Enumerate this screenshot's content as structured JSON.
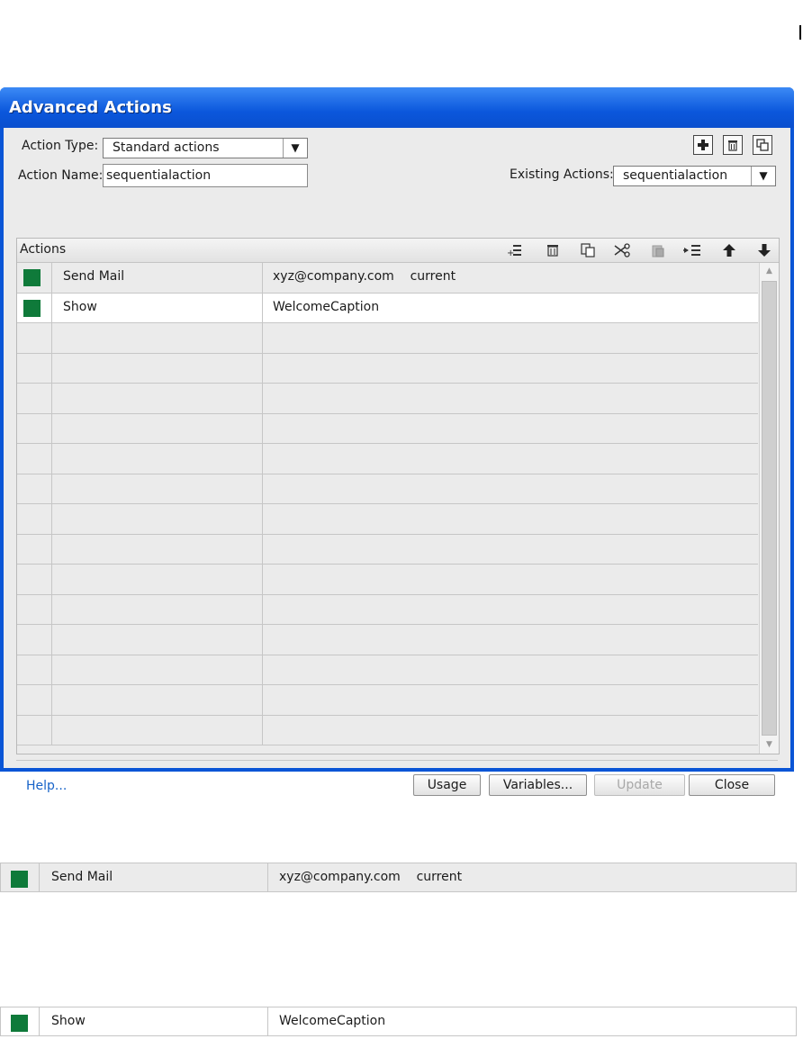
{
  "dialog": {
    "title": "Advanced Actions",
    "action_type_label": "Action Type:",
    "action_type_value": "Standard actions",
    "action_name_label": "Action Name:",
    "action_name_value": "sequentialaction",
    "existing_actions_label": "Existing Actions:",
    "existing_actions_value": "sequentialaction",
    "top_icons": [
      "add-icon",
      "trash-icon",
      "duplicate-icon"
    ],
    "grid": {
      "header_label": "Actions",
      "toolbar_icons": [
        "insert-row-icon",
        "delete-row-icon",
        "copy-icon",
        "cut-icon",
        "paste-icon",
        "indent-icon",
        "move-up-icon",
        "move-down-icon"
      ],
      "rows": [
        {
          "color": "#0f7a3a",
          "action": "Send Mail",
          "target": "xyz@company.com    current"
        },
        {
          "color": "#0f7a3a",
          "action": "Show",
          "target": "WelcomeCaption"
        }
      ],
      "empty_rows": 14
    },
    "help_link": "Help...",
    "buttons": {
      "usage": "Usage",
      "variables": "Variables...",
      "update": "Update",
      "close": "Close"
    }
  },
  "snippets": [
    {
      "color": "#0f7a3a",
      "action": "Send Mail",
      "target": "xyz@company.com    current"
    },
    {
      "color": "#0f7a3a",
      "action": "Show",
      "target": "WelcomeCaption"
    }
  ]
}
